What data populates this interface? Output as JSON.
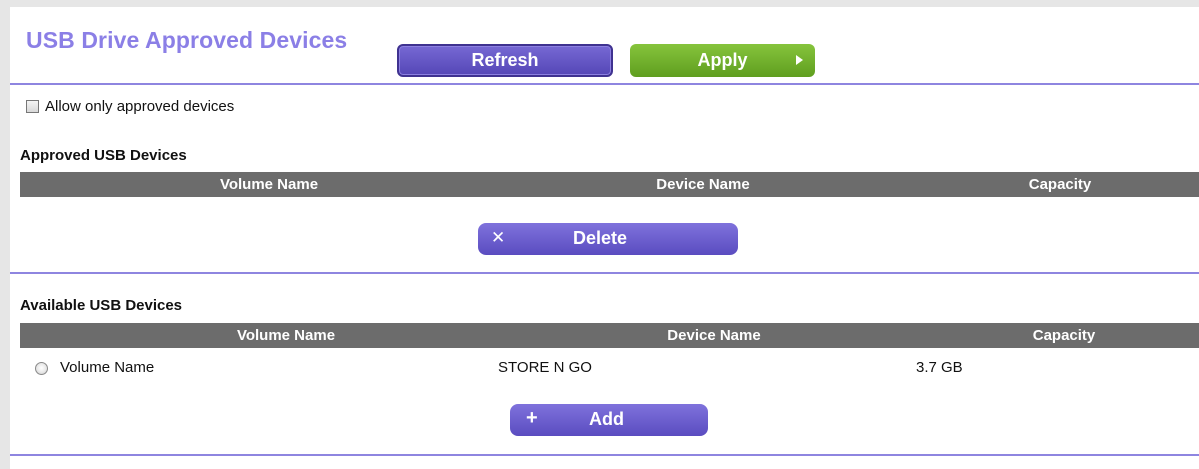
{
  "header": {
    "title": "USB Drive Approved Devices",
    "refresh_label": "Refresh",
    "apply_label": "Apply"
  },
  "allow_only_approved": {
    "label": "Allow only approved devices",
    "checked": false
  },
  "approved_section": {
    "title": "Approved USB Devices",
    "columns": [
      "Volume Name",
      "Device Name",
      "Capacity"
    ],
    "rows": [],
    "delete_label": "Delete",
    "delete_icon": "close-icon"
  },
  "available_section": {
    "title": "Available USB Devices",
    "columns": [
      "Volume Name",
      "Device Name",
      "Capacity"
    ],
    "rows": [
      {
        "volume_name": "Volume Name",
        "device_name": "STORE N GO",
        "capacity": "3.7 GB",
        "selected": false
      }
    ],
    "add_label": "Add",
    "add_icon": "plus-icon"
  },
  "colors": {
    "title": "#8b7fe6",
    "primary_button": "#6658c8",
    "apply_button": "#72b12c",
    "table_header": "#6c6c6c",
    "divider": "#8e85e0"
  }
}
